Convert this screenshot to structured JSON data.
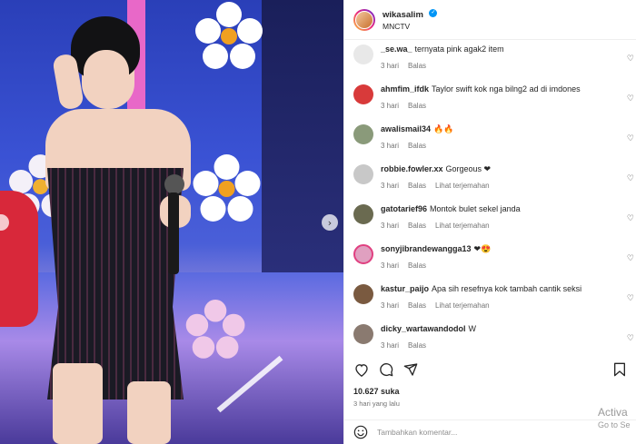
{
  "post": {
    "author": "wikasalim",
    "location": "MNCTV",
    "likes_text": "10.627 suka",
    "time_text": "3 hari yang lalu"
  },
  "comments": [
    {
      "user": "_se.wa_",
      "text": "ternyata pink agak2 item",
      "age": "3 hari",
      "reply": "Balas",
      "translate": ""
    },
    {
      "user": "ahmfim_ifdk",
      "text": "Taylor swift kok nga bilng2 ad di imdones",
      "age": "3 hari",
      "reply": "Balas",
      "translate": ""
    },
    {
      "user": "awalismail34",
      "text": "🔥🔥",
      "age": "3 hari",
      "reply": "Balas",
      "translate": ""
    },
    {
      "user": "robbie.fowler.xx",
      "text": "Gorgeous ❤",
      "age": "3 hari",
      "reply": "Balas",
      "translate": "Lihat terjemahan"
    },
    {
      "user": "gatotarief96",
      "text": "Montok bulet sekel janda",
      "age": "3 hari",
      "reply": "Balas",
      "translate": "Lihat terjemahan"
    },
    {
      "user": "sonyjibrandewangga13",
      "text": "❤😍",
      "age": "3 hari",
      "reply": "Balas",
      "translate": ""
    },
    {
      "user": "kastur_paijo",
      "text": "Apa sih resefnya kok tambah cantik seksi",
      "age": "3 hari",
      "reply": "Balas",
      "translate": "Lihat terjemahan"
    },
    {
      "user": "dicky_wartawandodol",
      "text": "W",
      "age": "3 hari",
      "reply": "Balas",
      "translate": ""
    }
  ],
  "composer": {
    "placeholder": "Tambahkan komentar..."
  },
  "watermark": {
    "line1": "Activa",
    "line2": "Go to Se"
  },
  "icons": {
    "like": "heart-icon",
    "comment": "comment-icon",
    "share": "share-icon",
    "save": "bookmark-icon",
    "emoji": "smiley-icon",
    "next": "chevron-right-icon",
    "prev": "chevron-left-icon"
  },
  "colors": {
    "verified": "#0095f6",
    "muted": "#737373",
    "text": "#262626",
    "story_ring_start": "#f9ce34",
    "story_ring_end": "#6228d7"
  }
}
